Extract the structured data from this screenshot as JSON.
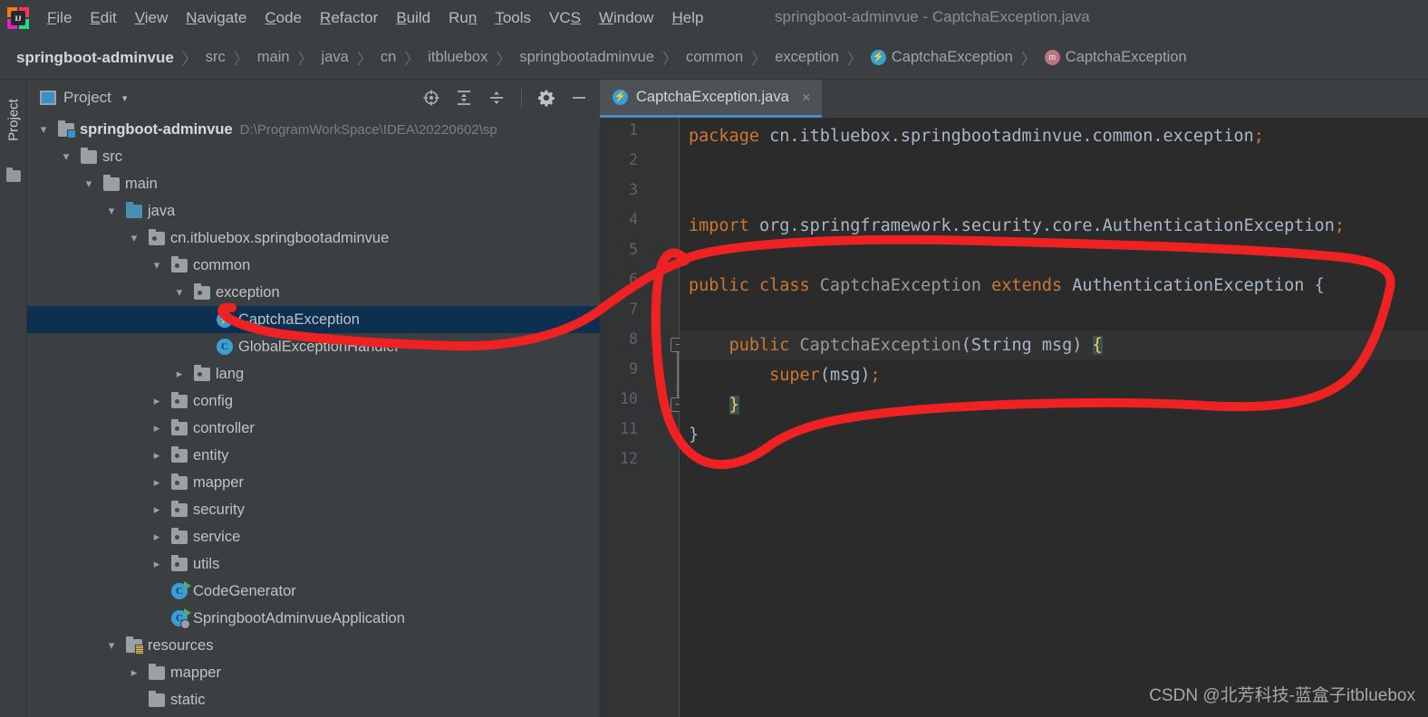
{
  "window": {
    "title": "springboot-adminvue - CaptchaException.java",
    "logo_label": "IJ"
  },
  "menubar": {
    "items": [
      {
        "label": "File",
        "mnemonic": "F"
      },
      {
        "label": "Edit",
        "mnemonic": "E"
      },
      {
        "label": "View",
        "mnemonic": "V"
      },
      {
        "label": "Navigate",
        "mnemonic": "N"
      },
      {
        "label": "Code",
        "mnemonic": "C"
      },
      {
        "label": "Refactor",
        "mnemonic": "R"
      },
      {
        "label": "Build",
        "mnemonic": "B"
      },
      {
        "label": "Run",
        "mnemonic": "n"
      },
      {
        "label": "Tools",
        "mnemonic": "T"
      },
      {
        "label": "VCS",
        "mnemonic": "S"
      },
      {
        "label": "Window",
        "mnemonic": "W"
      },
      {
        "label": "Help",
        "mnemonic": "H"
      }
    ]
  },
  "breadcrumb": {
    "separator": "〉",
    "items": [
      {
        "label": "springboot-adminvue",
        "icon": "none",
        "root": true
      },
      {
        "label": "src",
        "icon": "none"
      },
      {
        "label": "main",
        "icon": "none"
      },
      {
        "label": "java",
        "icon": "none"
      },
      {
        "label": "cn",
        "icon": "none"
      },
      {
        "label": "itbluebox",
        "icon": "none"
      },
      {
        "label": "springbootadminvue",
        "icon": "none"
      },
      {
        "label": "common",
        "icon": "none"
      },
      {
        "label": "exception",
        "icon": "none"
      },
      {
        "label": "CaptchaException",
        "icon": "exception-class-icon"
      },
      {
        "label": "CaptchaException",
        "icon": "method-icon"
      }
    ]
  },
  "tool_window": {
    "strip_label": "Project",
    "title": "Project",
    "caret": "▾",
    "actions": [
      {
        "name": "select-opened-file-icon",
        "glyph": "⊕"
      },
      {
        "name": "expand-all-icon",
        "glyph": "⥤"
      },
      {
        "name": "collapse-all-icon",
        "glyph": "⥥"
      },
      {
        "name": "settings-gear-icon",
        "glyph": "⚙"
      },
      {
        "name": "hide-minimize-icon",
        "glyph": "−"
      }
    ]
  },
  "tree": {
    "rows": [
      {
        "indent": 0,
        "twist": "open",
        "icon": "module",
        "label": "springboot-adminvue",
        "bold": true,
        "path": "D:\\ProgramWorkSpace\\IDEA\\20220602\\sp",
        "selected": false
      },
      {
        "indent": 1,
        "twist": "open",
        "icon": "folder",
        "label": "src",
        "bold": false,
        "path": "",
        "selected": false
      },
      {
        "indent": 2,
        "twist": "open",
        "icon": "folder",
        "label": "main",
        "bold": false,
        "path": "",
        "selected": false
      },
      {
        "indent": 3,
        "twist": "open",
        "icon": "source-folder",
        "label": "java",
        "bold": false,
        "path": "",
        "selected": false
      },
      {
        "indent": 4,
        "twist": "open",
        "icon": "package",
        "label": "cn.itbluebox.springbootadminvue",
        "bold": false,
        "path": "",
        "selected": false
      },
      {
        "indent": 5,
        "twist": "open",
        "icon": "package",
        "label": "common",
        "bold": false,
        "path": "",
        "selected": false
      },
      {
        "indent": 6,
        "twist": "open",
        "icon": "package",
        "label": "exception",
        "bold": false,
        "path": "",
        "selected": false
      },
      {
        "indent": 7,
        "twist": "none",
        "icon": "exception-class",
        "label": "CaptchaException",
        "bold": false,
        "path": "",
        "selected": true
      },
      {
        "indent": 7,
        "twist": "none",
        "icon": "class",
        "label": "GlobalExceptionHandler",
        "bold": false,
        "path": "",
        "selected": false
      },
      {
        "indent": 6,
        "twist": "closed",
        "icon": "package",
        "label": "lang",
        "bold": false,
        "path": "",
        "selected": false
      },
      {
        "indent": 5,
        "twist": "closed",
        "icon": "package",
        "label": "config",
        "bold": false,
        "path": "",
        "selected": false
      },
      {
        "indent": 5,
        "twist": "closed",
        "icon": "package",
        "label": "controller",
        "bold": false,
        "path": "",
        "selected": false
      },
      {
        "indent": 5,
        "twist": "closed",
        "icon": "package",
        "label": "entity",
        "bold": false,
        "path": "",
        "selected": false
      },
      {
        "indent": 5,
        "twist": "closed",
        "icon": "package",
        "label": "mapper",
        "bold": false,
        "path": "",
        "selected": false
      },
      {
        "indent": 5,
        "twist": "closed",
        "icon": "package",
        "label": "security",
        "bold": false,
        "path": "",
        "selected": false
      },
      {
        "indent": 5,
        "twist": "closed",
        "icon": "package",
        "label": "service",
        "bold": false,
        "path": "",
        "selected": false
      },
      {
        "indent": 5,
        "twist": "closed",
        "icon": "package",
        "label": "utils",
        "bold": false,
        "path": "",
        "selected": false
      },
      {
        "indent": 5,
        "twist": "none",
        "icon": "runnable-class",
        "label": "CodeGenerator",
        "bold": false,
        "path": "",
        "selected": false
      },
      {
        "indent": 5,
        "twist": "none",
        "icon": "spring-class",
        "label": "SpringbootAdminvueApplication",
        "bold": false,
        "path": "",
        "selected": false
      },
      {
        "indent": 3,
        "twist": "open",
        "icon": "resources-folder",
        "label": "resources",
        "bold": false,
        "path": "",
        "selected": false
      },
      {
        "indent": 4,
        "twist": "closed",
        "icon": "folder",
        "label": "mapper",
        "bold": false,
        "path": "",
        "selected": false
      },
      {
        "indent": 4,
        "twist": "none",
        "icon": "folder",
        "label": "static",
        "bold": false,
        "path": "",
        "selected": false
      }
    ]
  },
  "editor": {
    "tab": {
      "label": "CaptchaException.java",
      "icon": "exception-class-icon",
      "close_glyph": "×"
    },
    "line_numbers": [
      "1",
      "2",
      "3",
      "4",
      "5",
      "6",
      "7",
      "8",
      "9",
      "10",
      "11",
      "12"
    ],
    "fold_markers": [
      {
        "line": 8,
        "glyph": "−",
        "type": "fold-collapse-start"
      },
      {
        "line": 10,
        "glyph": "−",
        "type": "fold-collapse-end"
      }
    ],
    "caret_line": 8,
    "lines": [
      {
        "n": 1,
        "tokens": [
          {
            "t": "package",
            "c": "kw"
          },
          {
            "t": " cn.itbluebox.springbootadminvue.common.exception",
            "c": "id"
          },
          {
            "t": ";",
            "c": "kw"
          }
        ]
      },
      {
        "n": 2,
        "tokens": []
      },
      {
        "n": 3,
        "tokens": []
      },
      {
        "n": 4,
        "tokens": [
          {
            "t": "import",
            "c": "kw"
          },
          {
            "t": " org.springframework.security.core.AuthenticationException",
            "c": "id"
          },
          {
            "t": ";",
            "c": "kw"
          }
        ]
      },
      {
        "n": 5,
        "tokens": []
      },
      {
        "n": 6,
        "tokens": [
          {
            "t": "public class",
            "c": "kw"
          },
          {
            "t": " ",
            "c": "id"
          },
          {
            "t": "CaptchaException",
            "c": "cls"
          },
          {
            "t": " ",
            "c": "id"
          },
          {
            "t": "extends",
            "c": "kw"
          },
          {
            "t": " ",
            "c": "id"
          },
          {
            "t": "AuthenticationException",
            "c": "type"
          },
          {
            "t": " {",
            "c": "id"
          }
        ]
      },
      {
        "n": 7,
        "tokens": []
      },
      {
        "n": 8,
        "tokens": [
          {
            "t": "    ",
            "c": "id"
          },
          {
            "t": "public",
            "c": "kw"
          },
          {
            "t": " ",
            "c": "id"
          },
          {
            "t": "CaptchaException",
            "c": "cls"
          },
          {
            "t": "(",
            "c": "id"
          },
          {
            "t": "String",
            "c": "type"
          },
          {
            "t": " msg) ",
            "c": "id"
          },
          {
            "t": "{",
            "c": "brace-hl"
          }
        ]
      },
      {
        "n": 9,
        "tokens": [
          {
            "t": "        ",
            "c": "id"
          },
          {
            "t": "super",
            "c": "kw"
          },
          {
            "t": "(msg)",
            "c": "id"
          },
          {
            "t": ";",
            "c": "kw"
          }
        ]
      },
      {
        "n": 10,
        "tokens": [
          {
            "t": "    ",
            "c": "id"
          },
          {
            "t": "}",
            "c": "brace-hl"
          }
        ]
      },
      {
        "n": 11,
        "tokens": [
          {
            "t": "}",
            "c": "id"
          }
        ]
      },
      {
        "n": 12,
        "tokens": []
      }
    ]
  },
  "annotation": {
    "color": "#ee2222",
    "description": "hand-drawn red loop around class body with tail pointing to CaptchaException tree node"
  },
  "watermark": {
    "text": "CSDN @北芳科技-蓝盒子itbluebox"
  }
}
